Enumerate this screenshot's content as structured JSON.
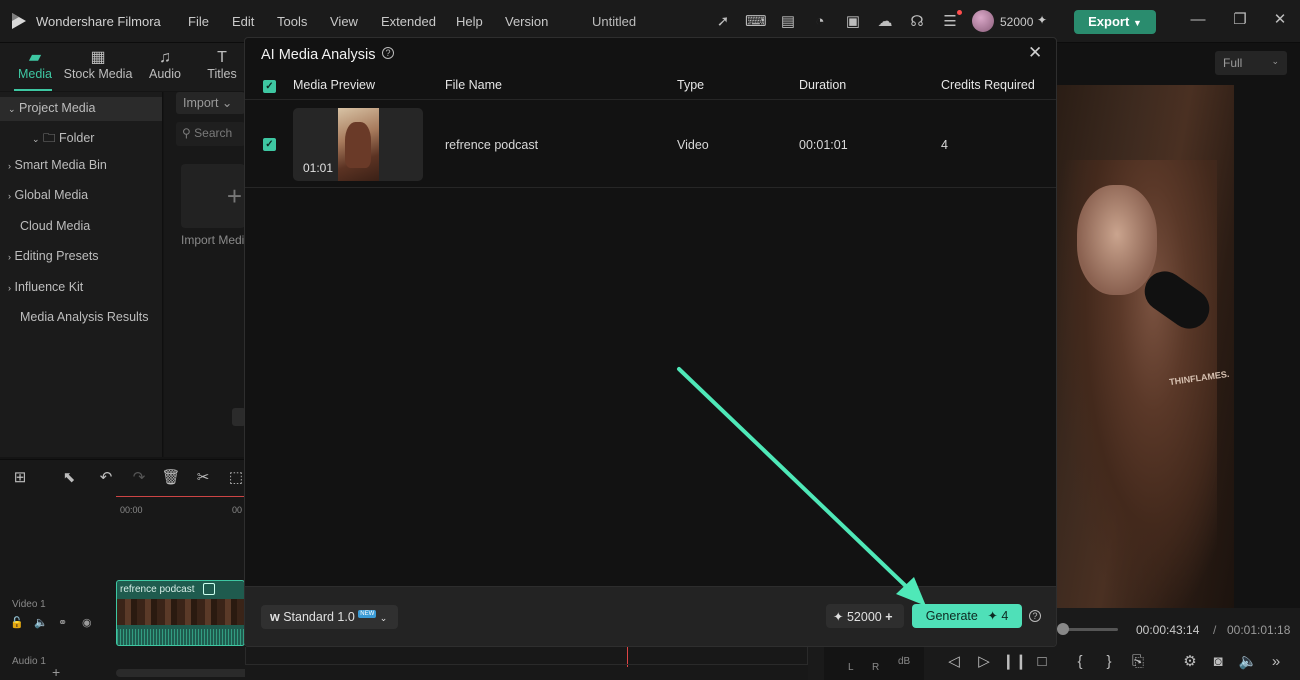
{
  "app": {
    "title": "Wondershare Filmora",
    "project": "Untitled",
    "credits": "52000",
    "export_label": "Export"
  },
  "menu": [
    "File",
    "Edit",
    "Tools",
    "View",
    "Extended",
    "Help",
    "Version"
  ],
  "tabs": [
    "Media",
    "Stock Media",
    "Audio",
    "Titles"
  ],
  "sidebar": {
    "items": [
      "Project Media",
      "Folder",
      "Smart Media Bin",
      "Global Media",
      "Cloud Media",
      "Editing Presets",
      "Influence Kit",
      "Media Analysis Results"
    ]
  },
  "media_panel": {
    "import_label": "Import",
    "search_placeholder": "Search",
    "import_media_label": "Import Media"
  },
  "timeline": {
    "time_start": "00:00",
    "time_next": "00",
    "clip_label": "refrence podcast",
    "video_track": "Video 1",
    "audio_track": "Audio 1"
  },
  "preview": {
    "zoom": "Full",
    "current_time": "00:00:43:14",
    "total_time": "00:01:01:18",
    "separator": "/",
    "shirt_text": "THINFLAMES.",
    "meter_l": "L",
    "meter_r": "R",
    "meter_db": "dB"
  },
  "modal": {
    "title": "AI Media Analysis",
    "columns": [
      "Media Preview",
      "File Name",
      "Type",
      "Duration",
      "Credits Required"
    ],
    "rows": [
      {
        "preview_duration": "01:01",
        "file_name": "refrence podcast",
        "type": "Video",
        "duration": "00:01:01",
        "credits": "4"
      }
    ],
    "model_label": "Standard 1.0",
    "model_badge": "NEW",
    "credits": "52000",
    "generate_label": "Generate",
    "generate_cost": "4"
  },
  "colors": {
    "accent": "#4fe0b8",
    "export_bg": "#2a8c6e",
    "annotation_arrow": "#4fe8b8"
  }
}
